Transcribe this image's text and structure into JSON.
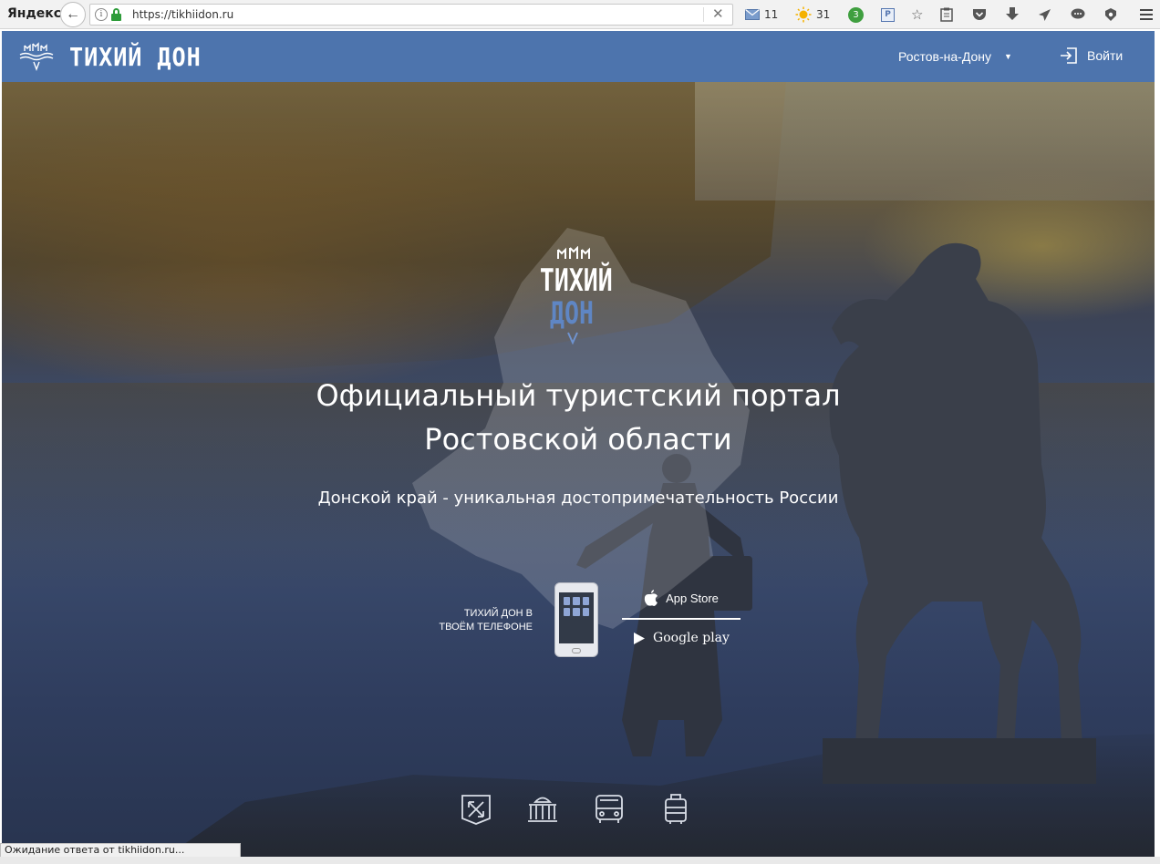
{
  "browser": {
    "brand": "Яндекс",
    "url": "https://tikhiidon.ru",
    "extensions": [
      {
        "icon": "mail-icon",
        "count": "11"
      },
      {
        "icon": "weather-sun-icon",
        "count": "31"
      },
      {
        "icon": "green-badge-icon",
        "count": "3"
      }
    ]
  },
  "header": {
    "logo_text": "ТИХИЙ ДОН",
    "city": "Ростов-на-Дону",
    "login_label": "Войти",
    "background": "#4d74ad"
  },
  "hero": {
    "emblem_line1": "ТИХИЙ",
    "emblem_line2": "ДОН",
    "title_line1": "Официальный туристский портал",
    "title_line2": "Ростовской области",
    "subtitle": "Донской край - уникальная достопримечательность России",
    "app_caption_line1": "ТИХИЙ ДОН В",
    "app_caption_line2": "ТВОЁМ ТЕЛЕФОНЕ",
    "app_store_label": "App Store",
    "google_play_label": "Google play"
  },
  "bottom_icons": [
    "routes-icon",
    "museum-icon",
    "bus-icon",
    "luggage-icon"
  ],
  "status": {
    "text": "Ожидание ответа от tikhiidon.ru..."
  }
}
